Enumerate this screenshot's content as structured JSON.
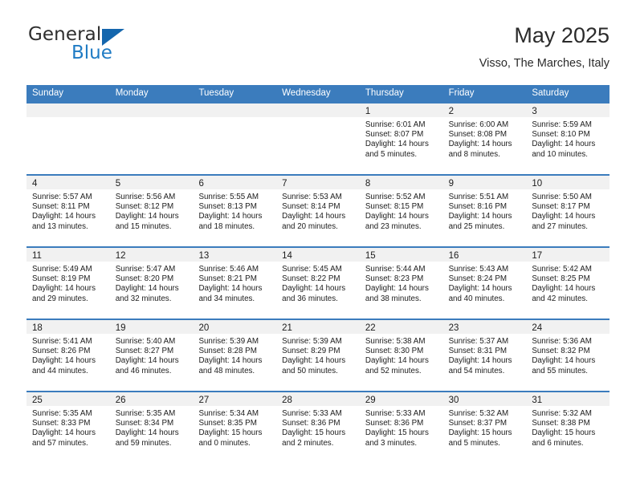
{
  "brand": {
    "name_part1": "General",
    "name_part2": "Blue",
    "logo_icon": "triangle-logo-icon",
    "accent_color": "#1466ad"
  },
  "header": {
    "title": "May 2025",
    "subtitle": "Visso, The Marches, Italy"
  },
  "theme": {
    "header_blue": "#3b7cbd",
    "band_gray": "#f1f1f1",
    "text": "#1c1c1c"
  },
  "weekday_headers": [
    "Sunday",
    "Monday",
    "Tuesday",
    "Wednesday",
    "Thursday",
    "Friday",
    "Saturday"
  ],
  "weeks": [
    [
      {
        "day": "",
        "sunrise": "",
        "sunset": "",
        "daylight1": "",
        "daylight2": ""
      },
      {
        "day": "",
        "sunrise": "",
        "sunset": "",
        "daylight1": "",
        "daylight2": ""
      },
      {
        "day": "",
        "sunrise": "",
        "sunset": "",
        "daylight1": "",
        "daylight2": ""
      },
      {
        "day": "",
        "sunrise": "",
        "sunset": "",
        "daylight1": "",
        "daylight2": ""
      },
      {
        "day": "1",
        "sunrise": "Sunrise: 6:01 AM",
        "sunset": "Sunset: 8:07 PM",
        "daylight1": "Daylight: 14 hours",
        "daylight2": "and 5 minutes."
      },
      {
        "day": "2",
        "sunrise": "Sunrise: 6:00 AM",
        "sunset": "Sunset: 8:08 PM",
        "daylight1": "Daylight: 14 hours",
        "daylight2": "and 8 minutes."
      },
      {
        "day": "3",
        "sunrise": "Sunrise: 5:59 AM",
        "sunset": "Sunset: 8:10 PM",
        "daylight1": "Daylight: 14 hours",
        "daylight2": "and 10 minutes."
      }
    ],
    [
      {
        "day": "4",
        "sunrise": "Sunrise: 5:57 AM",
        "sunset": "Sunset: 8:11 PM",
        "daylight1": "Daylight: 14 hours",
        "daylight2": "and 13 minutes."
      },
      {
        "day": "5",
        "sunrise": "Sunrise: 5:56 AM",
        "sunset": "Sunset: 8:12 PM",
        "daylight1": "Daylight: 14 hours",
        "daylight2": "and 15 minutes."
      },
      {
        "day": "6",
        "sunrise": "Sunrise: 5:55 AM",
        "sunset": "Sunset: 8:13 PM",
        "daylight1": "Daylight: 14 hours",
        "daylight2": "and 18 minutes."
      },
      {
        "day": "7",
        "sunrise": "Sunrise: 5:53 AM",
        "sunset": "Sunset: 8:14 PM",
        "daylight1": "Daylight: 14 hours",
        "daylight2": "and 20 minutes."
      },
      {
        "day": "8",
        "sunrise": "Sunrise: 5:52 AM",
        "sunset": "Sunset: 8:15 PM",
        "daylight1": "Daylight: 14 hours",
        "daylight2": "and 23 minutes."
      },
      {
        "day": "9",
        "sunrise": "Sunrise: 5:51 AM",
        "sunset": "Sunset: 8:16 PM",
        "daylight1": "Daylight: 14 hours",
        "daylight2": "and 25 minutes."
      },
      {
        "day": "10",
        "sunrise": "Sunrise: 5:50 AM",
        "sunset": "Sunset: 8:17 PM",
        "daylight1": "Daylight: 14 hours",
        "daylight2": "and 27 minutes."
      }
    ],
    [
      {
        "day": "11",
        "sunrise": "Sunrise: 5:49 AM",
        "sunset": "Sunset: 8:19 PM",
        "daylight1": "Daylight: 14 hours",
        "daylight2": "and 29 minutes."
      },
      {
        "day": "12",
        "sunrise": "Sunrise: 5:47 AM",
        "sunset": "Sunset: 8:20 PM",
        "daylight1": "Daylight: 14 hours",
        "daylight2": "and 32 minutes."
      },
      {
        "day": "13",
        "sunrise": "Sunrise: 5:46 AM",
        "sunset": "Sunset: 8:21 PM",
        "daylight1": "Daylight: 14 hours",
        "daylight2": "and 34 minutes."
      },
      {
        "day": "14",
        "sunrise": "Sunrise: 5:45 AM",
        "sunset": "Sunset: 8:22 PM",
        "daylight1": "Daylight: 14 hours",
        "daylight2": "and 36 minutes."
      },
      {
        "day": "15",
        "sunrise": "Sunrise: 5:44 AM",
        "sunset": "Sunset: 8:23 PM",
        "daylight1": "Daylight: 14 hours",
        "daylight2": "and 38 minutes."
      },
      {
        "day": "16",
        "sunrise": "Sunrise: 5:43 AM",
        "sunset": "Sunset: 8:24 PM",
        "daylight1": "Daylight: 14 hours",
        "daylight2": "and 40 minutes."
      },
      {
        "day": "17",
        "sunrise": "Sunrise: 5:42 AM",
        "sunset": "Sunset: 8:25 PM",
        "daylight1": "Daylight: 14 hours",
        "daylight2": "and 42 minutes."
      }
    ],
    [
      {
        "day": "18",
        "sunrise": "Sunrise: 5:41 AM",
        "sunset": "Sunset: 8:26 PM",
        "daylight1": "Daylight: 14 hours",
        "daylight2": "and 44 minutes."
      },
      {
        "day": "19",
        "sunrise": "Sunrise: 5:40 AM",
        "sunset": "Sunset: 8:27 PM",
        "daylight1": "Daylight: 14 hours",
        "daylight2": "and 46 minutes."
      },
      {
        "day": "20",
        "sunrise": "Sunrise: 5:39 AM",
        "sunset": "Sunset: 8:28 PM",
        "daylight1": "Daylight: 14 hours",
        "daylight2": "and 48 minutes."
      },
      {
        "day": "21",
        "sunrise": "Sunrise: 5:39 AM",
        "sunset": "Sunset: 8:29 PM",
        "daylight1": "Daylight: 14 hours",
        "daylight2": "and 50 minutes."
      },
      {
        "day": "22",
        "sunrise": "Sunrise: 5:38 AM",
        "sunset": "Sunset: 8:30 PM",
        "daylight1": "Daylight: 14 hours",
        "daylight2": "and 52 minutes."
      },
      {
        "day": "23",
        "sunrise": "Sunrise: 5:37 AM",
        "sunset": "Sunset: 8:31 PM",
        "daylight1": "Daylight: 14 hours",
        "daylight2": "and 54 minutes."
      },
      {
        "day": "24",
        "sunrise": "Sunrise: 5:36 AM",
        "sunset": "Sunset: 8:32 PM",
        "daylight1": "Daylight: 14 hours",
        "daylight2": "and 55 minutes."
      }
    ],
    [
      {
        "day": "25",
        "sunrise": "Sunrise: 5:35 AM",
        "sunset": "Sunset: 8:33 PM",
        "daylight1": "Daylight: 14 hours",
        "daylight2": "and 57 minutes."
      },
      {
        "day": "26",
        "sunrise": "Sunrise: 5:35 AM",
        "sunset": "Sunset: 8:34 PM",
        "daylight1": "Daylight: 14 hours",
        "daylight2": "and 59 minutes."
      },
      {
        "day": "27",
        "sunrise": "Sunrise: 5:34 AM",
        "sunset": "Sunset: 8:35 PM",
        "daylight1": "Daylight: 15 hours",
        "daylight2": "and 0 minutes."
      },
      {
        "day": "28",
        "sunrise": "Sunrise: 5:33 AM",
        "sunset": "Sunset: 8:36 PM",
        "daylight1": "Daylight: 15 hours",
        "daylight2": "and 2 minutes."
      },
      {
        "day": "29",
        "sunrise": "Sunrise: 5:33 AM",
        "sunset": "Sunset: 8:36 PM",
        "daylight1": "Daylight: 15 hours",
        "daylight2": "and 3 minutes."
      },
      {
        "day": "30",
        "sunrise": "Sunrise: 5:32 AM",
        "sunset": "Sunset: 8:37 PM",
        "daylight1": "Daylight: 15 hours",
        "daylight2": "and 5 minutes."
      },
      {
        "day": "31",
        "sunrise": "Sunrise: 5:32 AM",
        "sunset": "Sunset: 8:38 PM",
        "daylight1": "Daylight: 15 hours",
        "daylight2": "and 6 minutes."
      }
    ]
  ]
}
